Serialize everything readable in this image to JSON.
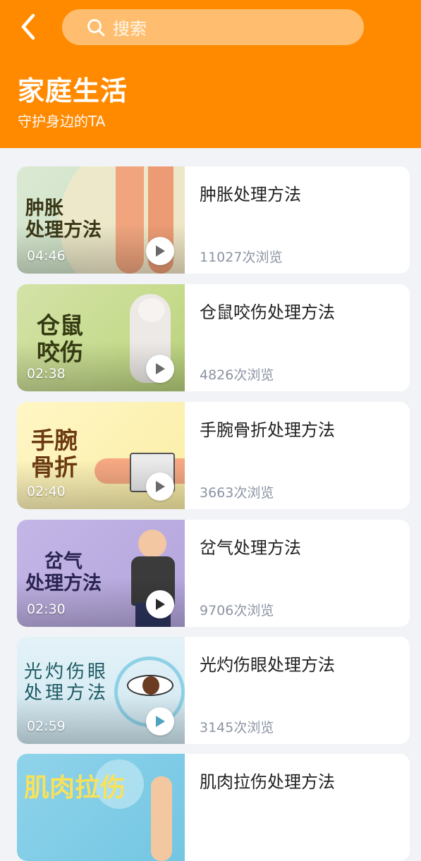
{
  "header": {
    "search_placeholder": "搜索",
    "title": "家庭生活",
    "subtitle": "守护身边的TA",
    "accent": "#ff8a00",
    "icons": [
      "back-arrow-icon",
      "search-icon"
    ]
  },
  "videos": [
    {
      "thumb_text": "肿胀\n处理方法",
      "duration": "04:46",
      "title": "肿胀处理方法",
      "views": "11027次浏览"
    },
    {
      "thumb_text": "仓鼠\n咬伤",
      "duration": "02:38",
      "title": "仓鼠咬伤处理方法",
      "views": "4826次浏览"
    },
    {
      "thumb_text": "手腕\n骨折",
      "duration": "02:40",
      "title": "手腕骨折处理方法",
      "views": "3663次浏览"
    },
    {
      "thumb_text": "岔气\n处理方法",
      "duration": "02:30",
      "title": "岔气处理方法",
      "views": "9706次浏览"
    },
    {
      "thumb_text": "光灼伤眼\n处理方法",
      "duration": "02:59",
      "title": "光灼伤眼处理方法",
      "views": "3145次浏览"
    },
    {
      "thumb_text": "肌肉拉伤",
      "duration": "",
      "title": "肌肉拉伤处理方法",
      "views": ""
    }
  ]
}
